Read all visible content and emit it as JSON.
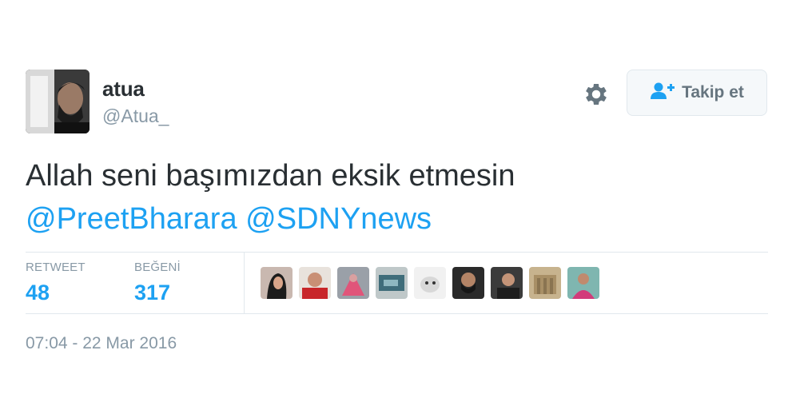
{
  "user": {
    "display_name": "atua",
    "screen_name": "@Atua_"
  },
  "actions": {
    "settings_icon": "gear-icon",
    "follow_label": "Takip et",
    "follow_icon": "add-user-icon"
  },
  "tweet": {
    "text": "Allah seni başımızdan eksik etmesin",
    "mentions": [
      "@PreetBharara",
      "@SDNYnews"
    ],
    "timestamp": "07:04 - 22 Mar 2016"
  },
  "stats": {
    "retweet_label": "RETWEET",
    "retweet_count": "48",
    "like_label": "BEĞENİ",
    "like_count": "317"
  },
  "colors": {
    "link": "#1da1f2",
    "muted": "#8899a6",
    "text": "#292f33"
  }
}
